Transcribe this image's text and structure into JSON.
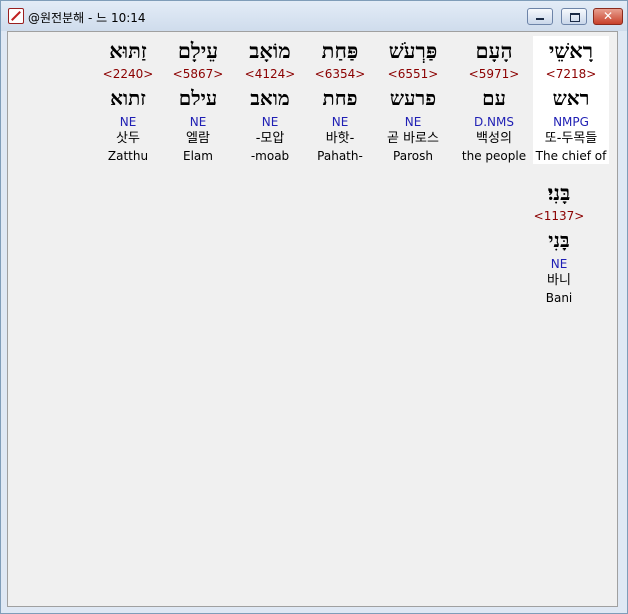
{
  "window": {
    "title": "@원전분해 - 느 10:14",
    "minimize_icon": "minimize-icon",
    "maximize_icon": "maximize-icon",
    "close_icon": "close-icon",
    "close_glyph": "✕"
  },
  "row1": [
    {
      "pointed": "רָאשֵׁי",
      "strong": "<7218>",
      "plain": "ראש",
      "morph": "NMPG",
      "korean": "또-두목들",
      "english": "The chief of",
      "highlight": true
    },
    {
      "pointed": "הָעָם",
      "strong": "<5971>",
      "plain": "עם",
      "morph": "D.NMS",
      "korean": "백성의",
      "english": "the people",
      "highlight": false
    },
    {
      "pointed": "פַּרְעֹשׁ",
      "strong": "<6551>",
      "plain": "פרעש",
      "morph": "NE",
      "korean": "곧 바로스",
      "english": "Parosh",
      "highlight": false
    },
    {
      "pointed": "פַּחַת",
      "strong": "<6354>",
      "plain": "פחת",
      "morph": "NE",
      "korean": "바핫-",
      "english": "Pahath-",
      "highlight": false
    },
    {
      "pointed": "מוֹאָב",
      "strong": "<4124>",
      "plain": "מואב",
      "morph": "NE",
      "korean": "-모압",
      "english": "-moab",
      "highlight": false
    },
    {
      "pointed": "עֵילָם",
      "strong": "<5867>",
      "plain": "עילם",
      "morph": "NE",
      "korean": "엘람",
      "english": "Elam",
      "highlight": false
    },
    {
      "pointed": "זַתּוּא",
      "strong": "<2240>",
      "plain": "זתוא",
      "morph": "NE",
      "korean": "삿두",
      "english": "Zatthu",
      "highlight": false
    }
  ],
  "row2": [
    {
      "pointed": "בָּנִי׃",
      "strong": "<1137>",
      "plain": "בָּנִי",
      "morph": "NE",
      "korean": "바니",
      "english": "Bani",
      "highlight": false
    }
  ]
}
